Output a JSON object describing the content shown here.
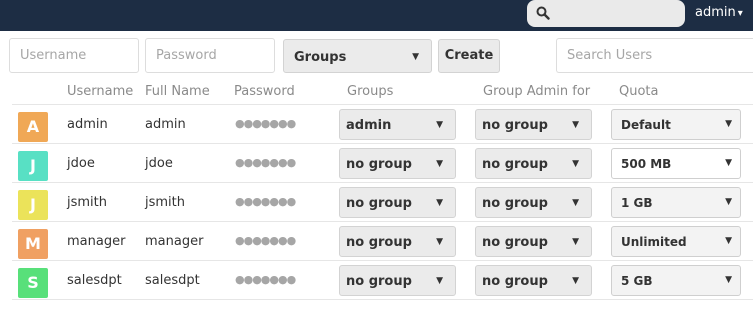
{
  "topbar": {
    "user_menu_label": "admin",
    "caret": "▾"
  },
  "new_user": {
    "username_placeholder": "Username",
    "password_placeholder": "Password",
    "groups_select": "Groups",
    "create_label": "Create",
    "search_placeholder": "Search Users"
  },
  "columns": [
    "Username",
    "Full Name",
    "Password",
    "Groups",
    "Group Admin for",
    "Quota"
  ],
  "users": [
    {
      "initial": "A",
      "color": "#f0a856",
      "username": "admin",
      "fullname": "admin",
      "password": "●●●●●●●",
      "groups": "admin",
      "group_admin": "no group",
      "quota": "Default"
    },
    {
      "initial": "J",
      "color": "#58e0c4",
      "username": "jdoe",
      "fullname": "jdoe",
      "password": "●●●●●●●",
      "groups": "no group",
      "group_admin": "no group",
      "quota": "500 MB"
    },
    {
      "initial": "J",
      "color": "#ebe35a",
      "username": "jsmith",
      "fullname": "jsmith",
      "password": "●●●●●●●",
      "groups": "no group",
      "group_admin": "no group",
      "quota": "1 GB"
    },
    {
      "initial": "M",
      "color": "#f0a062",
      "username": "manager",
      "fullname": "manager",
      "password": "●●●●●●●",
      "groups": "no group",
      "group_admin": "no group",
      "quota": "Unlimited"
    },
    {
      "initial": "S",
      "color": "#58e07a",
      "username": "salesdpt",
      "fullname": "salesdpt",
      "password": "●●●●●●●",
      "groups": "no group",
      "group_admin": "no group",
      "quota": "5 GB"
    }
  ],
  "arrow": "▼"
}
